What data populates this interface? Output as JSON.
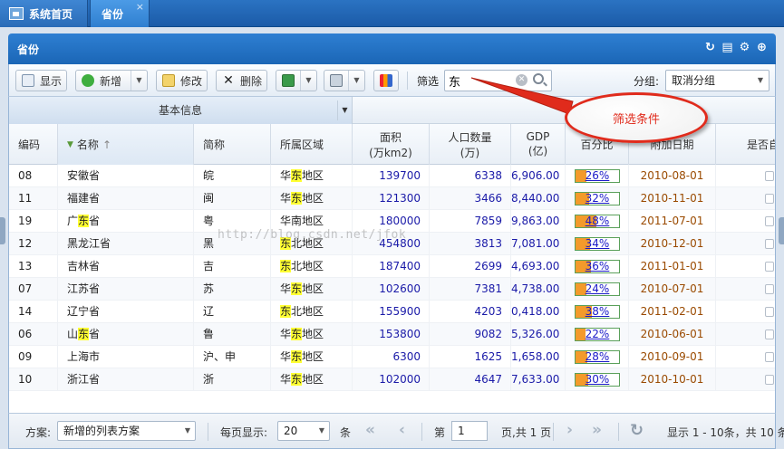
{
  "tabs": [
    {
      "label": "系统首页",
      "icon": "home-icon"
    },
    {
      "label": "省份",
      "closable": true,
      "close_glyph": "×"
    }
  ],
  "panel": {
    "title": "省份",
    "tools": [
      {
        "name": "refresh-icon",
        "glyph": "↻"
      },
      {
        "name": "print-icon",
        "glyph": "▤"
      },
      {
        "name": "settings-icon",
        "glyph": "⚙"
      },
      {
        "name": "collapse-icon",
        "glyph": "⊕"
      }
    ]
  },
  "toolbar": {
    "show_label": "显示",
    "add_label": "新增",
    "edit_label": "修改",
    "delete_label": "删除",
    "filter_label": "筛选",
    "filter_value": "东",
    "group_label": "分组:",
    "group_value": "取消分组"
  },
  "grid": {
    "group_header": "基本信息",
    "columns": [
      "编码",
      "名称",
      "简称",
      "所属区域",
      "面积\n(万km2)",
      "人口数量\n(万)",
      "GDP\n(亿)",
      "百分比",
      "附加日期",
      "是否自"
    ],
    "rows": [
      {
        "code": "08",
        "name": [
          "安徽省"
        ],
        "abbr": "皖",
        "region": [
          "华",
          "东",
          "地区"
        ],
        "area": "139700",
        "pop": "6338",
        "gdp": "6,906.00",
        "pct": 26,
        "pct_label": "26%",
        "date": "2010-08-01"
      },
      {
        "code": "11",
        "name": [
          "福建省"
        ],
        "abbr": "闽",
        "region": [
          "华",
          "东",
          "地区"
        ],
        "area": "121300",
        "pop": "3466",
        "gdp": "8,440.00",
        "pct": 32,
        "pct_label": "32%",
        "date": "2010-11-01"
      },
      {
        "code": "19",
        "name": [
          "广",
          "东",
          "省"
        ],
        "abbr": "粤",
        "region": [
          "华南地区"
        ],
        "area": "180000",
        "pop": "7859",
        "gdp": "9,863.00",
        "pct": 48,
        "pct_label": "48%",
        "date": "2011-07-01"
      },
      {
        "code": "12",
        "name": [
          "黑龙江省"
        ],
        "abbr": "黑",
        "region": [
          "",
          "东",
          "北地区"
        ],
        "area": "454800",
        "pop": "3813",
        "gdp": "7,081.00",
        "pct": 34,
        "pct_label": "34%",
        "date": "2010-12-01"
      },
      {
        "code": "13",
        "name": [
          "吉林省"
        ],
        "abbr": "吉",
        "region": [
          "",
          "东",
          "北地区"
        ],
        "area": "187400",
        "pop": "2699",
        "gdp": "4,693.00",
        "pct": 36,
        "pct_label": "36%",
        "date": "2011-01-01"
      },
      {
        "code": "07",
        "name": [
          "江苏省"
        ],
        "abbr": "苏",
        "region": [
          "华",
          "东",
          "地区"
        ],
        "area": "102600",
        "pop": "7381",
        "gdp": "4,738.00",
        "pct": 24,
        "pct_label": "24%",
        "date": "2010-07-01"
      },
      {
        "code": "14",
        "name": [
          "辽宁省"
        ],
        "abbr": "辽",
        "region": [
          "",
          "东",
          "北地区"
        ],
        "area": "155900",
        "pop": "4203",
        "gdp": "0,418.00",
        "pct": 38,
        "pct_label": "38%",
        "date": "2011-02-01"
      },
      {
        "code": "06",
        "name": [
          "山",
          "东",
          "省"
        ],
        "abbr": "鲁",
        "region": [
          "华",
          "东",
          "地区"
        ],
        "area": "153800",
        "pop": "9082",
        "gdp": "5,326.00",
        "pct": 22,
        "pct_label": "22%",
        "date": "2010-06-01"
      },
      {
        "code": "09",
        "name": [
          "上海市"
        ],
        "abbr": "沪、申",
        "region": [
          "华",
          "东",
          "地区"
        ],
        "area": "6300",
        "pop": "1625",
        "gdp": "1,658.00",
        "pct": 28,
        "pct_label": "28%",
        "date": "2010-09-01"
      },
      {
        "code": "10",
        "name": [
          "浙江省"
        ],
        "abbr": "浙",
        "region": [
          "华",
          "东",
          "地区"
        ],
        "area": "102000",
        "pop": "4647",
        "gdp": "7,633.00",
        "pct": 30,
        "pct_label": "30%",
        "date": "2010-10-01"
      }
    ]
  },
  "watermark": "http://blog.csdn.net/jfok",
  "callout": "筛选条件",
  "pager": {
    "scheme_label": "方案:",
    "scheme_value": "新增的列表方案",
    "per_page_label": "每页显示:",
    "per_page_value": "20",
    "per_page_unit": "条",
    "page_prefix": "第",
    "page_value": "1",
    "page_suffix": "页,共 1 页",
    "summary": "显示 1 - 10条，共 10 条"
  },
  "colors": {
    "accent": "#1b66b6",
    "highlight": "#ffff33",
    "number": "#1a1aa8",
    "date": "#9a4a00",
    "callout": "#e02b1c"
  }
}
